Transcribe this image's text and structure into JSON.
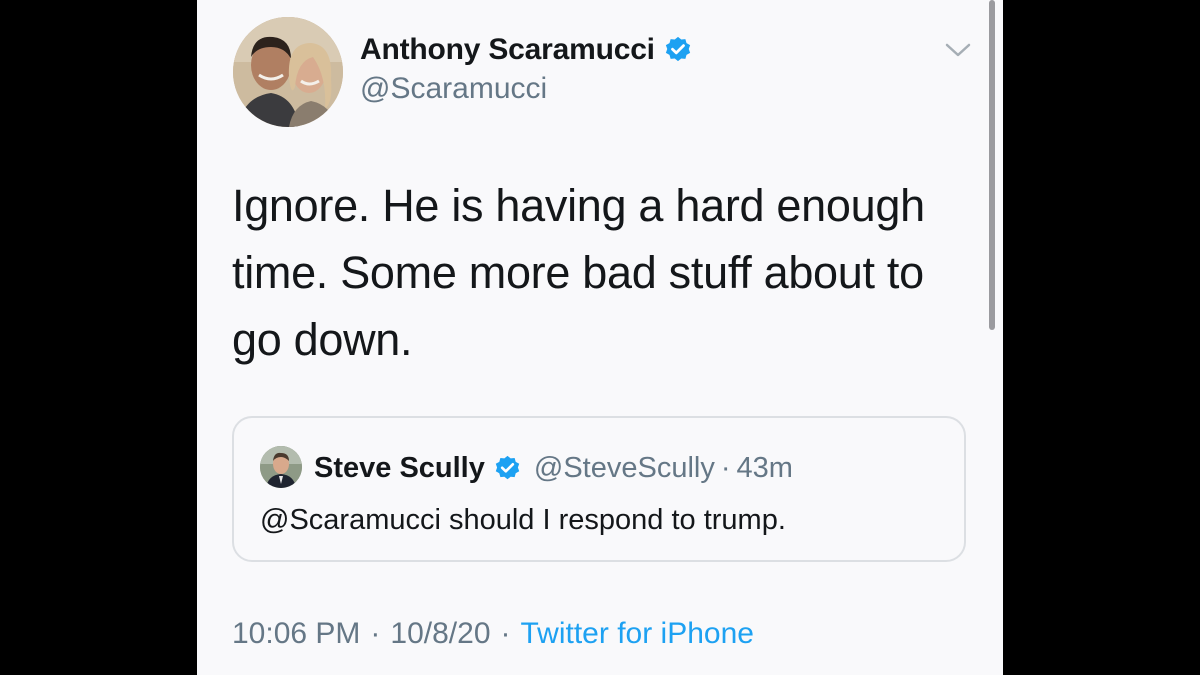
{
  "tweet": {
    "author": {
      "name": "Anthony Scaramucci",
      "handle": "@Scaramucci",
      "verified": true
    },
    "text": "Ignore. He is having a hard enough time. Some more bad stuff about to go down.",
    "quoted_tweet": {
      "author_name": "Steve Scully",
      "author_handle": "@SteveScully",
      "verified": true,
      "separator": "·",
      "time_ago": "43m",
      "text": "@Scaramucci should I respond to trump."
    },
    "meta": {
      "time": "10:06 PM",
      "separator": "·",
      "date": "10/8/20",
      "source": "Twitter for iPhone"
    }
  },
  "icons": {
    "verified": "verified-badge-icon",
    "more": "chevron-down-icon"
  },
  "colors": {
    "verified_blue": "#1da1f2",
    "text_primary": "#14171a",
    "text_secondary": "#657786",
    "card_border": "#dcdfe3",
    "background": "#f9f9fb"
  }
}
